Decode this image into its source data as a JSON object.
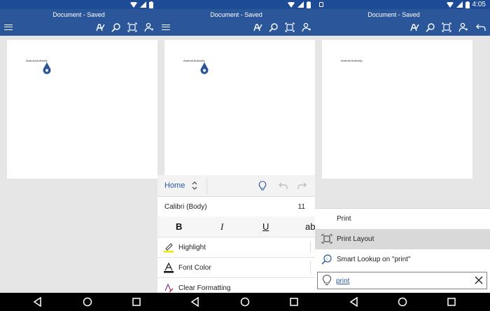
{
  "status_bar": {
    "time": "4:05"
  },
  "document": {
    "title": "Document - Saved",
    "body_text": "Android Authority"
  },
  "ribbon": {
    "tab_label": "Home",
    "font_name": "Calibri (Body)",
    "font_size": "11",
    "format_buttons": {
      "bold": "B",
      "italic": "I",
      "underline": "U",
      "more": "ab"
    },
    "options": {
      "highlight": "Highlight",
      "font_color": "Font Color",
      "clear_formatting": "Clear Formatting"
    }
  },
  "tell_me": {
    "results": {
      "print": "Print",
      "print_layout": "Print Layout",
      "smart_lookup": "Smart Lookup on \"print\""
    },
    "query": "print"
  },
  "colors": {
    "title_bar": "#2b579a",
    "status_bar": "#1d4b96",
    "highlight": "#f2e600",
    "accent": "#2b579a"
  }
}
